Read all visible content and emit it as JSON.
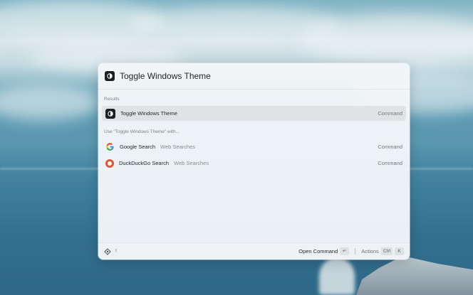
{
  "palette": {
    "search": {
      "value": "Toggle Windows Theme",
      "placeholder": ""
    },
    "sections": {
      "results_label": "Results",
      "fallback_label": "Use \"Toggle Windows Theme\" with..."
    },
    "results": [
      {
        "icon": "theme-toggle-icon",
        "title": "Toggle Windows Theme",
        "subtitle": "",
        "type": "Command",
        "selected": true
      }
    ],
    "fallbacks": [
      {
        "icon": "google-icon",
        "title": "Google Search",
        "subtitle": "Web Searches",
        "type": "Command"
      },
      {
        "icon": "duckduckgo-icon",
        "title": "DuckDuckGo Search",
        "subtitle": "Web Searches",
        "type": "Command"
      }
    ],
    "footer": {
      "left_icon": "extension-icon",
      "left_hint": "!",
      "primary_action": "Open Command",
      "primary_key": "↵",
      "actions_label": "Actions",
      "actions_keys": [
        "Ctrl",
        "K"
      ]
    }
  },
  "colors": {
    "selection": "#dfe3e6",
    "palette_bg": "#f3f6f8",
    "ddg_orange": "#de5833"
  }
}
